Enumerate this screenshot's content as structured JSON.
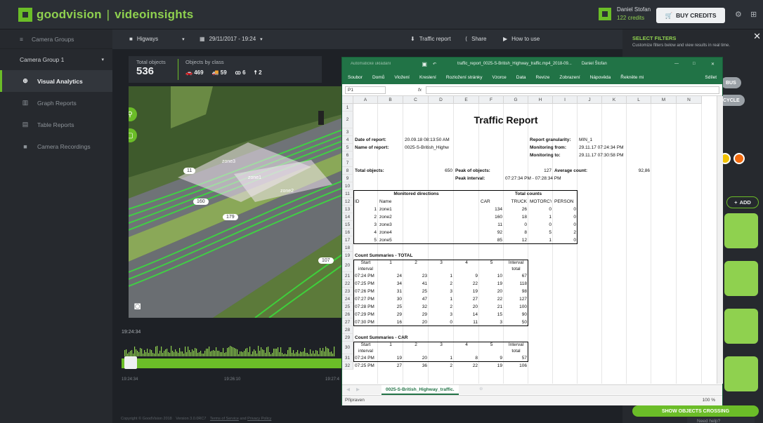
{
  "brand": {
    "name": "goodvision",
    "separator": "|",
    "product": "videoinsights"
  },
  "user": {
    "name": "Daniel Stofan",
    "credits": "122 credits"
  },
  "header": {
    "buy_label": "BUY CREDITS"
  },
  "sidebar": {
    "groups_label": "Camera Groups",
    "selected_group": "Camera Group 1",
    "items": [
      {
        "label": "Visual Analytics",
        "active": true
      },
      {
        "label": "Graph Reports"
      },
      {
        "label": "Table Reports"
      },
      {
        "label": "Camera Recordings"
      }
    ]
  },
  "toolbar": {
    "camera": "Higways",
    "date": "29/11/2017 - 19:24",
    "traffic_report": "Traffic report",
    "share": "Share",
    "how_to": "How to use"
  },
  "stats": {
    "total_label": "Total objects",
    "total_value": "536",
    "class_label": "Objects by class",
    "classes": [
      {
        "icon": "car-icon",
        "count": "469"
      },
      {
        "icon": "truck-icon",
        "count": "59"
      },
      {
        "icon": "motorcycle-icon",
        "count": "6"
      },
      {
        "icon": "person-icon",
        "count": "2"
      }
    ]
  },
  "video": {
    "zones": [
      {
        "name": "zone3"
      },
      {
        "name": "zone1"
      },
      {
        "name": "zone2"
      }
    ],
    "tags": [
      "11",
      "160",
      "179",
      "107"
    ]
  },
  "timeline": {
    "current": "19:24:34",
    "ticks": [
      "19:24:34",
      "19:26:10",
      "19:27:4"
    ],
    "progress": 0.02
  },
  "footer": {
    "copyright": "Copyright © GoodVision 2018",
    "version": "Version 3.0.0RC7",
    "terms": "Terms of Service",
    "and": "and",
    "privacy": "Privacy Policy"
  },
  "filters": {
    "title": "SELECT FILTERS",
    "subtitle": "Customize filters below and view results in real time.",
    "pills": [
      "BUS",
      "CYCLE"
    ],
    "add_label": "ADD",
    "show_crossing": "SHOW OBJECTS CROSSING",
    "need_help": "Need help?",
    "dot_colors": [
      "#f2c200",
      "#f26b0f"
    ]
  },
  "excel": {
    "autosave": "Automatické ukládání",
    "filename": "traffic_report_0025-S-British_Highway_traffic.mp4_2018-09...",
    "user": "Daniel Štofan",
    "ribbon": [
      "Soubor",
      "Domů",
      "Vložení",
      "Kreslení",
      "Rozložení stránky",
      "Vzorce",
      "Data",
      "Revize",
      "Zobrazení",
      "Nápověda",
      "Řekněte mi"
    ],
    "share": "Sdílet",
    "namebox": "P1",
    "fx": "fx",
    "columns": [
      "A",
      "B",
      "C",
      "D",
      "E",
      "F",
      "G",
      "H",
      "I",
      "J",
      "K",
      "L",
      "M",
      "N"
    ],
    "rows": [
      "1",
      "2",
      "3",
      "4",
      "5",
      "6",
      "7",
      "8",
      "9",
      "10",
      "11",
      "12",
      "13",
      "14",
      "15",
      "16",
      "17",
      "18",
      "19",
      "20",
      "21",
      "22",
      "23",
      "24",
      "25",
      "26",
      "27",
      "28",
      "29",
      "30",
      "31",
      "32"
    ],
    "report_title": "Traffic Report",
    "meta": {
      "date_label": "Date of report:",
      "date_value": "20.09.18 08:13:50 AM",
      "name_label": "Name of report:",
      "name_value": "0025-S-British_Highw",
      "gran_label": "Report granularity:",
      "gran_value": "MIN_1",
      "from_label": "Monitoring from:",
      "from_value": "29.11.17 07:24:34 PM",
      "to_label": "Monitoring to:",
      "to_value": "29.11.17 07:30:58 PM",
      "total_label": "Total objects:",
      "total_value": "650",
      "peak_label": "Peak of objects:",
      "peak_value": "127",
      "avg_label": "Average count:",
      "avg_value": "92,86",
      "interval_label": "Peak interval:",
      "interval_value": "07:27:34 PM - 07:28:34 PM"
    },
    "directions": {
      "title": "Monitored directions",
      "totals_title": "Total counts",
      "headers": [
        "ID",
        "Name",
        "CAR",
        "TRUCK",
        "MOTORCY",
        "PERSON"
      ],
      "rows": [
        [
          "1",
          "zone1",
          "134",
          "26",
          "0",
          "0"
        ],
        [
          "2",
          "zone2",
          "160",
          "18",
          "1",
          "0"
        ],
        [
          "3",
          "zone3",
          "11",
          "0",
          "0",
          "0"
        ],
        [
          "4",
          "zone4",
          "92",
          "8",
          "5",
          "2"
        ],
        [
          "5",
          "zone5",
          "85",
          "12",
          "1",
          "0"
        ]
      ]
    },
    "total_summary": {
      "title": "Count Summaries - TOTAL",
      "headers": [
        "Start interval",
        "1",
        "2",
        "3",
        "4",
        "5",
        "Interval total"
      ],
      "rows": [
        [
          "07:24 PM",
          "24",
          "23",
          "1",
          "9",
          "10",
          "67"
        ],
        [
          "07:25 PM",
          "34",
          "41",
          "2",
          "22",
          "19",
          "118"
        ],
        [
          "07:26 PM",
          "31",
          "25",
          "3",
          "19",
          "20",
          "98"
        ],
        [
          "07:27 PM",
          "30",
          "47",
          "1",
          "27",
          "22",
          "127"
        ],
        [
          "07:28 PM",
          "25",
          "32",
          "2",
          "20",
          "21",
          "100"
        ],
        [
          "07:29 PM",
          "29",
          "29",
          "3",
          "14",
          "15",
          "90"
        ],
        [
          "07:30 PM",
          "16",
          "20",
          "0",
          "11",
          "3",
          "50"
        ]
      ]
    },
    "car_summary": {
      "title": "Count Summaries - CAR",
      "headers": [
        "Start interval",
        "1",
        "2",
        "3",
        "4",
        "5",
        "Interval total"
      ],
      "rows": [
        [
          "07:24 PM",
          "19",
          "20",
          "1",
          "8",
          "9",
          "57"
        ],
        [
          "07:25 PM",
          "27",
          "36",
          "2",
          "22",
          "19",
          "106"
        ]
      ]
    },
    "sheet_tab": "0025-S-British_Highway_traffic.",
    "status": "Připraven",
    "zoom": "100 %"
  }
}
